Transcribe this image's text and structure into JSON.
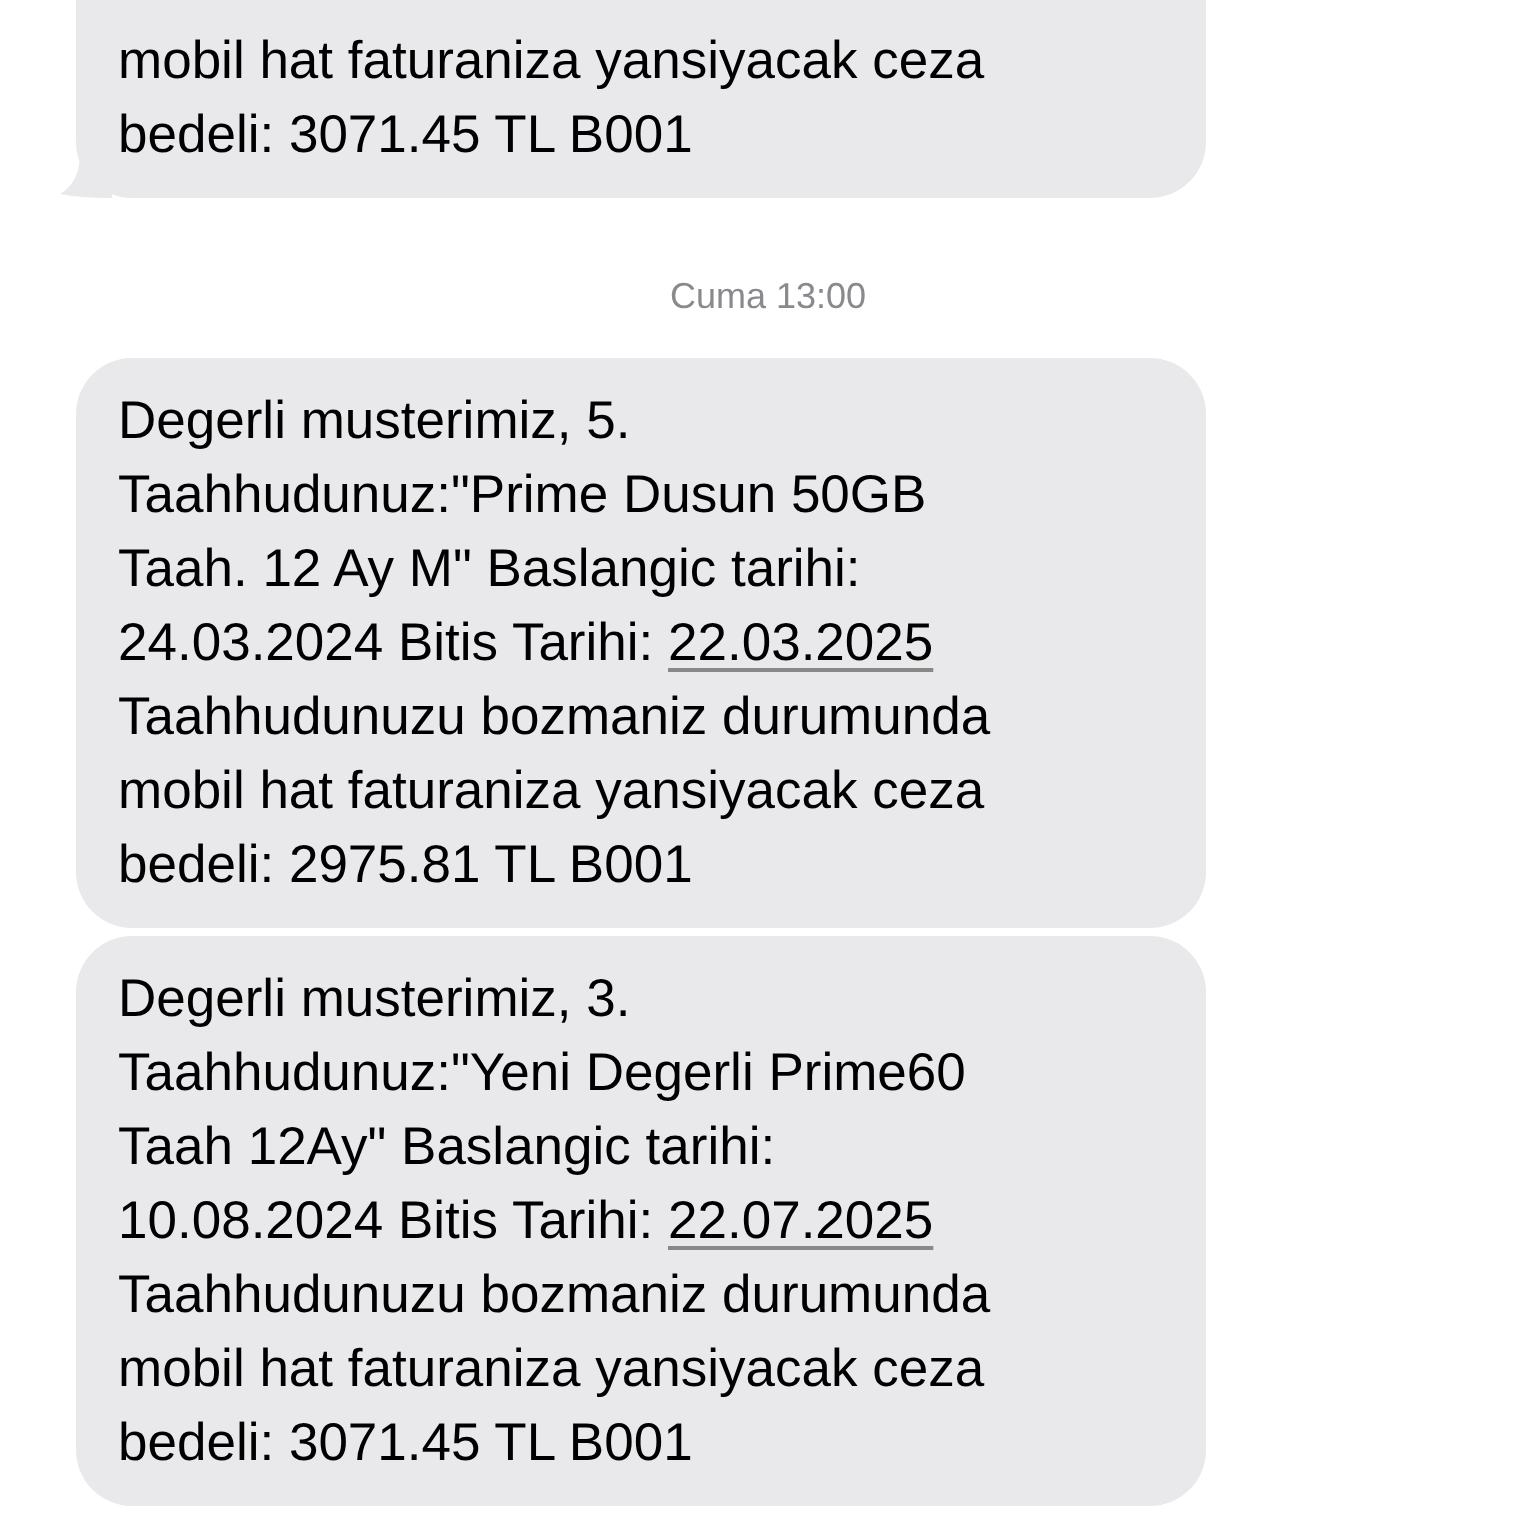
{
  "messages": [
    {
      "tail": true,
      "parts": [
        {
          "kind": "text",
          "text": "mobil hat faturaniza yansiyacak ceza\nbedeli: 3071.45 TL B001"
        }
      ]
    },
    {
      "kind": "timestamp",
      "text": "Cuma 13:00"
    },
    {
      "tail": false,
      "parts": [
        {
          "kind": "text",
          "text": "Degerli musterimiz, 5.\nTaahhudunuz:\"Prime Dusun 50GB\nTaah. 12 Ay M\" Baslangic tarihi:\n24.03.2024 Bitis Tarihi: "
        },
        {
          "kind": "link",
          "text": "22.03.2025"
        },
        {
          "kind": "text",
          "text": "\nTaahhudunuzu bozmaniz durumunda\nmobil hat faturaniza yansiyacak ceza\nbedeli: 2975.81 TL B001"
        }
      ]
    },
    {
      "tail": false,
      "parts": [
        {
          "kind": "text",
          "text": "Degerli musterimiz, 3.\nTaahhudunuz:\"Yeni Degerli Prime60\nTaah 12Ay\" Baslangic tarihi:\n10.08.2024 Bitis Tarihi: "
        },
        {
          "kind": "link",
          "text": "22.07.2025"
        },
        {
          "kind": "text",
          "text": "\nTaahhudunuzu bozmaniz durumunda\nmobil hat faturaniza yansiyacak ceza\nbedeli: 3071.45 TL B001"
        }
      ]
    }
  ]
}
